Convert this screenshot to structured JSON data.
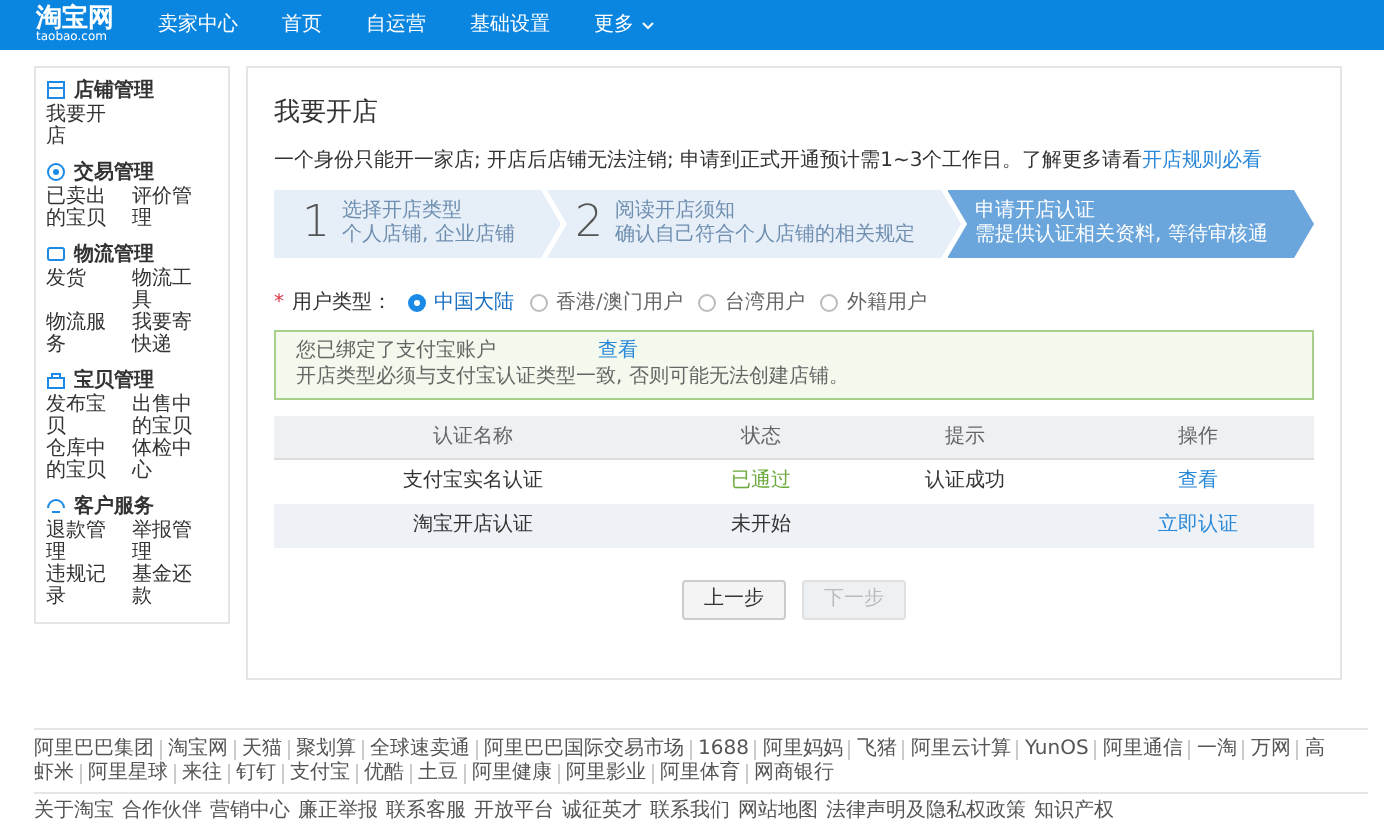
{
  "navbar": {
    "logo": "淘宝网",
    "logo_sub": "taobao.com",
    "title": "卖家中心",
    "items": [
      {
        "label": "首页",
        "has_caret": false
      },
      {
        "label": "自运营",
        "has_caret": false
      },
      {
        "label": "基础设置",
        "has_caret": false
      },
      {
        "label": "更多",
        "has_caret": true
      }
    ]
  },
  "sidebar": {
    "groups": [
      {
        "kind": "store",
        "title": "店铺管理",
        "items": [
          "我要开店"
        ]
      },
      {
        "kind": "trade",
        "title": "交易管理",
        "items": [
          "已卖出的宝贝",
          "评价管理"
        ]
      },
      {
        "kind": "logistics",
        "title": "物流管理",
        "items": [
          "发货",
          "物流工具",
          "物流服务",
          "我要寄快递"
        ]
      },
      {
        "kind": "goods",
        "title": "宝贝管理",
        "items": [
          "发布宝贝",
          "出售中的宝贝",
          "仓库中的宝贝",
          "体检中心"
        ]
      },
      {
        "kind": "service",
        "title": "客户服务",
        "items": [
          "退款管理",
          "举报管理",
          "违规记录",
          "基金还款"
        ]
      }
    ]
  },
  "main": {
    "title": "我要开店",
    "intro": "一个身份只能开一家店; 开店后店铺无法注销; 申请到正式开通预计需1~3个工作日。了解更多请看",
    "intro_link": "开店规则必看",
    "steps": [
      {
        "number": "1",
        "title": "选择开店类型",
        "desc": "个人店铺, 企业店铺",
        "selected": false
      },
      {
        "number": "2",
        "title": "阅读开店须知",
        "desc": "确认自己符合个人店铺的相关规定",
        "selected": false
      },
      {
        "title": "申请开店认证",
        "desc": "需提供认证相关资料, 等待审核通",
        "selected": true
      }
    ],
    "user_type": {
      "required_mark": "*",
      "label": "用户类型：",
      "options": [
        {
          "label": "中国大陆",
          "selected": true
        },
        {
          "label": "香港/澳门用户",
          "selected": false
        },
        {
          "label": "台湾用户",
          "selected": false
        },
        {
          "label": "外籍用户",
          "selected": false
        }
      ]
    },
    "notice": {
      "line_1": "您已绑定了支付宝账户",
      "line_1_link": "查看",
      "line_2": "开店类型必须与支付宝认证类型一致, 否则可能无法创建店铺。"
    },
    "table": {
      "columns": [
        "认证名称",
        "状态",
        "提示",
        "操作"
      ],
      "rows": [
        {
          "name": "支付宝实名认证",
          "status": "已通过",
          "kind": "passed",
          "hint": "认证成功",
          "action": "查看"
        },
        {
          "name": "淘宝开店认证",
          "status": "未开始",
          "kind": "pending",
          "action": "立即认证"
        }
      ]
    },
    "buttons": [
      {
        "label": "上一步",
        "disabled": false
      },
      {
        "label": "下一步",
        "disabled": true
      }
    ]
  },
  "footer": {
    "row_1": [
      "阿里巴巴集团",
      "淘宝网",
      "天猫",
      "聚划算",
      "全球速卖通",
      "阿里巴巴国际交易市场",
      "1688",
      "阿里妈妈",
      "飞猪",
      "阿里云计算",
      "YunOS",
      "阿里通信",
      "一淘",
      "万网",
      "高"
    ],
    "row_2": [
      "虾米",
      "阿里星球",
      "来往",
      "钉钉",
      "支付宝",
      "优酷",
      "土豆",
      "阿里健康",
      "阿里影业",
      "阿里体育",
      "网商银行"
    ],
    "row_3": [
      "关于淘宝",
      "合作伙伴",
      "营销中心",
      "廉正举报",
      "联系客服",
      "开放平台",
      "诚征英才",
      "联系我们",
      "网站地图",
      "法律声明及隐私权政策",
      "知识产权"
    ]
  }
}
